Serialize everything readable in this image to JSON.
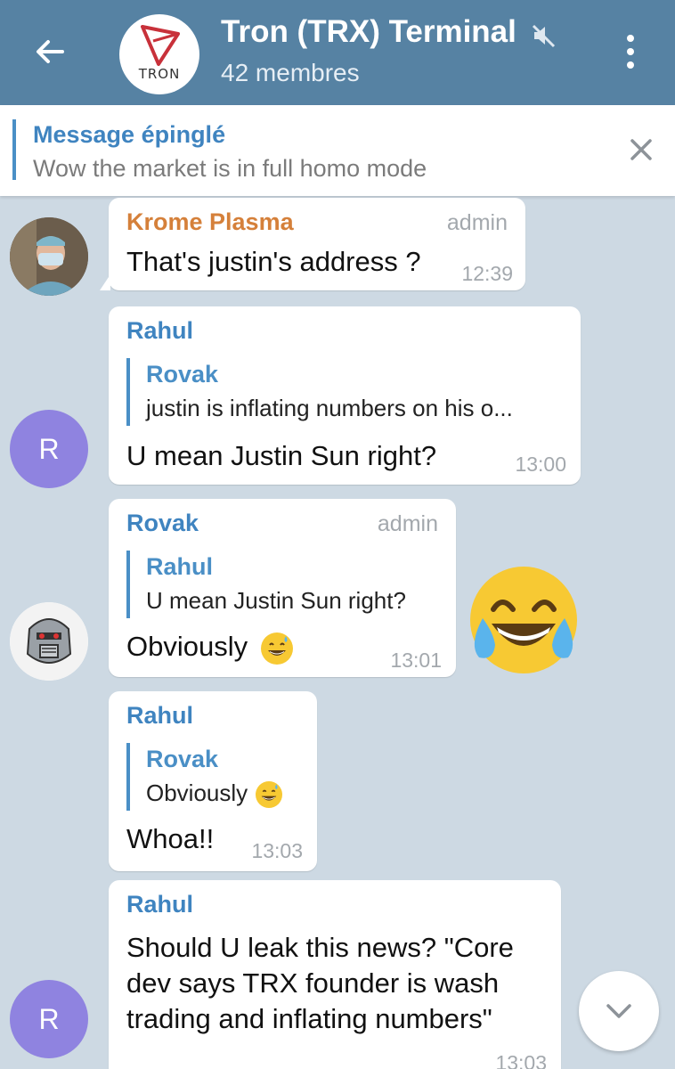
{
  "header": {
    "title": "Tron (TRX) Terminal",
    "member_count": "42 membres",
    "avatar_text": "TRON"
  },
  "pinned": {
    "title": "Message épinglé",
    "text": "Wow the market is in full homo mode"
  },
  "messages": [
    {
      "sender": "Krome Plasma",
      "badge": "admin",
      "text": "That's justin's address ?",
      "time": "12:39"
    },
    {
      "sender": "Rahul",
      "avatar_letter": "R",
      "reply_name": "Rovak",
      "reply_text": "justin is inflating numbers on his o...",
      "text": "U mean Justin Sun right?",
      "time": "13:00"
    },
    {
      "sender": "Rovak",
      "badge": "admin",
      "reply_name": "Rahul",
      "reply_text": "U mean Justin Sun right?",
      "text": "Obviously",
      "time": "13:01"
    },
    {
      "sender": "Rahul",
      "reply_name": "Rovak",
      "reply_text": "Obviously",
      "text": "Whoa!!",
      "time": "13:03"
    },
    {
      "sender": "Rahul",
      "avatar_letter": "R",
      "text_lines": [
        "Should U leak this news? \"Core",
        "dev says TRX founder is wash",
        "trading and inflating numbers\""
      ],
      "time": "13:03"
    }
  ],
  "colors": {
    "header_bg": "#5682a3",
    "sender_orange": "#d5803a",
    "sender_blue": "#3f84c0",
    "avatar_purple": "#8f83e0",
    "chat_bg": "#cdd9e3"
  },
  "icons": [
    "back-arrow-icon",
    "mute-icon",
    "more-vert-icon",
    "close-icon",
    "chevron-down-icon",
    "grin-sweat-emoji",
    "tears-of-joy-emoji"
  ]
}
